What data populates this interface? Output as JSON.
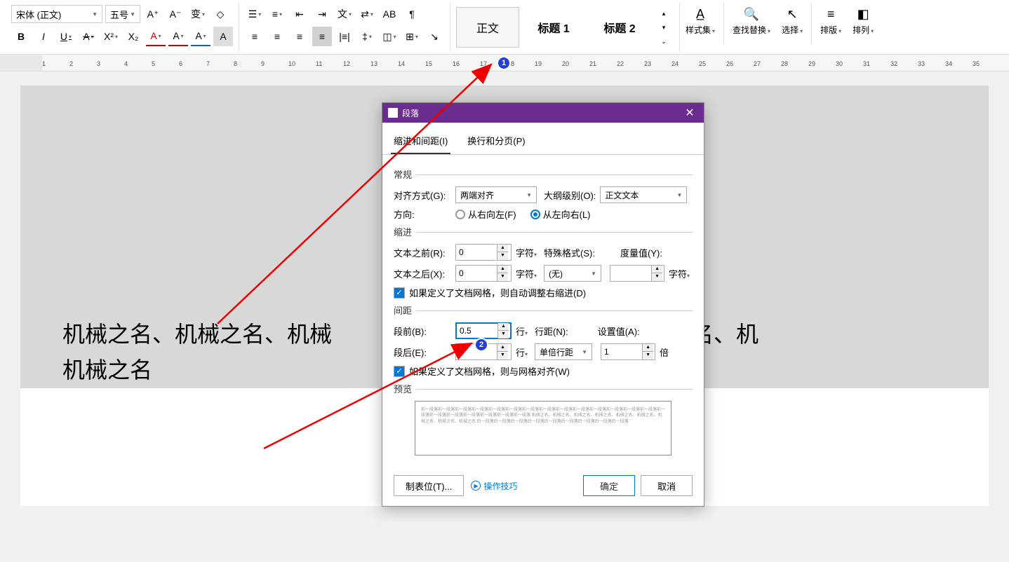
{
  "ribbon": {
    "font_name": "宋体 (正文)",
    "font_size": "五号",
    "bold": "B",
    "italic": "I",
    "underline": "U",
    "strike": "A",
    "super": "X²",
    "sub": "X₂",
    "fontcolor": "A",
    "highlight": "A",
    "charshade": "A",
    "clearfmt": "A",
    "grow": "A⁺",
    "shrink": "A⁻",
    "pinyin": "变",
    "eraser": "◇"
  },
  "styles": {
    "normal": "正文",
    "h1": "标题 1",
    "h2": "标题 2",
    "styleset": "样式集",
    "findreplace": "查找替换",
    "select": "选择",
    "layout": "排版",
    "arrange": "排列"
  },
  "ruler_marks": [
    "1",
    "2",
    "3",
    "4",
    "5",
    "6",
    "7",
    "8",
    "9",
    "10",
    "11",
    "12",
    "13",
    "14",
    "15",
    "16",
    "17",
    "18",
    "19",
    "20",
    "21",
    "22",
    "23",
    "24",
    "25",
    "26",
    "27",
    "28",
    "29",
    "30",
    "31",
    "32",
    "33",
    "34",
    "35"
  ],
  "doc": {
    "line1": "机械之名、机械之名、机械",
    "line1b": "机械之名、机械之名、机",
    "line2": "机械之名"
  },
  "dialog": {
    "title": "段落",
    "tab1": "缩进和间距(I)",
    "tab2": "换行和分页(P)",
    "sec_general": "常规",
    "alignment_label": "对齐方式(G):",
    "alignment_value": "两端对齐",
    "outline_label": "大纲级别(O):",
    "outline_value": "正文文本",
    "direction_label": "方向:",
    "dir_rtl": "从右向左(F)",
    "dir_ltr": "从左向右(L)",
    "sec_indent": "缩进",
    "indent_before_label": "文本之前(R):",
    "indent_before_value": "0",
    "indent_unit": "字符",
    "special_label": "特殊格式(S):",
    "measure_label": "度量值(Y):",
    "indent_after_label": "文本之后(X):",
    "indent_after_value": "0",
    "special_value": "(无)",
    "chk_grid_indent": "如果定义了文档网格，则自动调整右缩进(D)",
    "sec_spacing": "间距",
    "space_before_label": "段前(B):",
    "space_before_value": "0.5",
    "space_unit": "行",
    "linespace_label": "行距(N):",
    "setvalue_label": "设置值(A):",
    "space_after_label": "段后(E):",
    "space_after_value": "0",
    "linespace_value": "单倍行距",
    "setvalue_value": "1",
    "setvalue_unit": "倍",
    "chk_grid_align": "如果定义了文档网格，则与网格对齐(W)",
    "sec_preview": "预览",
    "preview_text": "前一段落前一段落前一段落前一段落前一段落前一段落前一段落前一段落前一段落前一段落前一段落前一段落前一段落前一段落前一段落前一段落前一段落前一段落前一段落前一段落前一段落 机械之名、机械之名、机械之名、机械之名、机械之名、机械之名、机械之名、机械之名、机械之名 后一段落后一段落后一段落后一段落后一段落后一段落后一段落后一段落后一段落",
    "tabstops": "制表位(T)...",
    "tips": "操作技巧",
    "ok": "确定",
    "cancel": "取消"
  },
  "badges": {
    "b1": "1",
    "b2": "2"
  }
}
